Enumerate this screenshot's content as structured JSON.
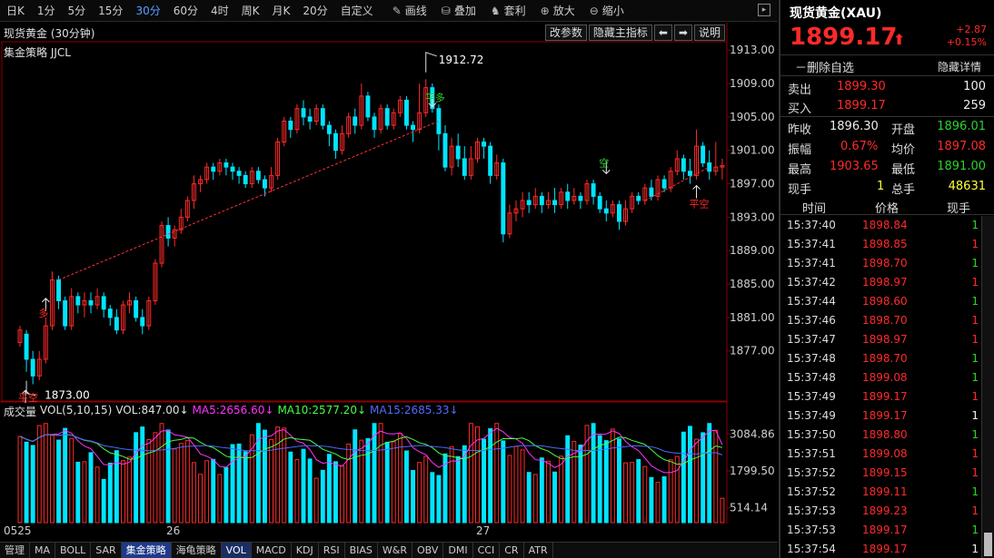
{
  "toolbar": {
    "periods": [
      "日K",
      "1分",
      "5分",
      "15分",
      "30分",
      "60分",
      "4时",
      "周K",
      "月K",
      "20分",
      "自定义"
    ],
    "active_period": "30分",
    "tools": [
      {
        "icon": "pencil-icon",
        "label": "画线"
      },
      {
        "icon": "layers-icon",
        "label": "叠加"
      },
      {
        "icon": "bag-icon",
        "label": "套利"
      },
      {
        "icon": "zoom-in-icon",
        "label": "放大"
      },
      {
        "icon": "zoom-out-icon",
        "label": "缩小"
      }
    ]
  },
  "main": {
    "title": "现货黄金 (30分钟)",
    "strategy": "集金策略 JJCL",
    "buttons": [
      "改参数",
      "隐藏主指标",
      "⬅",
      "➡",
      "说明"
    ],
    "y_ticks": [
      "1913.00",
      "1909.00",
      "1905.00",
      "1901.00",
      "1897.00",
      "1893.00",
      "1889.00",
      "1885.00",
      "1881.00",
      "1877.00"
    ],
    "annotations": {
      "high_label": "1912.72",
      "low_label": "1873.00",
      "signals": [
        "平多",
        "多",
        "空",
        "平空",
        "平空"
      ]
    }
  },
  "volume": {
    "label": "成交量",
    "params": "VOL(5,10,15)",
    "vol": "VOL:847.00↓",
    "ma5": "MA5:2656.60↓",
    "ma10": "MA10:2577.20↓",
    "ma15": "MA15:2685.33↓",
    "buttons": [
      "改参数",
      "说明",
      "X"
    ],
    "y_ticks": [
      "3084.86",
      "1799.50",
      "514.14"
    ]
  },
  "dates": [
    "0525",
    "26",
    "27"
  ],
  "bottom_tabs": [
    "管理",
    "MA",
    "BOLL",
    "SAR",
    "集金策略",
    "海龟策略",
    "VOL",
    "MACD",
    "KDJ",
    "RSI",
    "BIAS",
    "W&R",
    "OBV",
    "DMI",
    "CCI",
    "CR",
    "ATR"
  ],
  "active_tab": "集金策略",
  "highlight_tab": "VOL",
  "quote": {
    "name": "现货黄金(XAU)",
    "price": "1899.17",
    "arrow": "⬆",
    "change": "+2.87",
    "change_pct": "+0.15%",
    "delete_label": "－删除自选",
    "hide_label": "隐藏详情",
    "sell_label": "卖出",
    "sell_price": "1899.30",
    "sell_qty": "100",
    "buy_label": "买入",
    "buy_price": "1899.17",
    "buy_qty": "259",
    "prev_close_label": "昨收",
    "prev_close": "1896.30",
    "open_label": "开盘",
    "open": "1896.01",
    "amp_label": "振幅",
    "amp": "0.67%",
    "avg_label": "均价",
    "avg": "1897.08",
    "high_label": "最高",
    "high": "1903.65",
    "low_label": "最低",
    "low": "1891.00",
    "cur_label": "现手",
    "cur": "1",
    "total_label": "总手",
    "total": "48631"
  },
  "trades_header": {
    "time": "时间",
    "price": "价格",
    "qty": "现手"
  },
  "trades": [
    {
      "time": "15:37:40",
      "price": "1898.84",
      "qty": "1",
      "color": "green"
    },
    {
      "time": "15:37:41",
      "price": "1898.85",
      "qty": "1",
      "color": "red"
    },
    {
      "time": "15:37:41",
      "price": "1898.70",
      "qty": "1",
      "color": "green"
    },
    {
      "time": "15:37:42",
      "price": "1898.97",
      "qty": "1",
      "color": "red"
    },
    {
      "time": "15:37:44",
      "price": "1898.60",
      "qty": "1",
      "color": "green"
    },
    {
      "time": "15:37:46",
      "price": "1898.70",
      "qty": "1",
      "color": "red"
    },
    {
      "time": "15:37:47",
      "price": "1898.97",
      "qty": "1",
      "color": "red"
    },
    {
      "time": "15:37:48",
      "price": "1898.70",
      "qty": "1",
      "color": "green"
    },
    {
      "time": "15:37:48",
      "price": "1899.08",
      "qty": "1",
      "color": "green"
    },
    {
      "time": "15:37:49",
      "price": "1899.17",
      "qty": "1",
      "color": "red"
    },
    {
      "time": "15:37:49",
      "price": "1899.17",
      "qty": "1",
      "color": "white"
    },
    {
      "time": "15:37:50",
      "price": "1898.80",
      "qty": "1",
      "color": "green"
    },
    {
      "time": "15:37:51",
      "price": "1899.08",
      "qty": "1",
      "color": "red"
    },
    {
      "time": "15:37:52",
      "price": "1899.15",
      "qty": "1",
      "color": "red"
    },
    {
      "time": "15:37:52",
      "price": "1899.11",
      "qty": "1",
      "color": "green"
    },
    {
      "time": "15:37:53",
      "price": "1899.23",
      "qty": "1",
      "color": "red"
    },
    {
      "time": "15:37:53",
      "price": "1899.17",
      "qty": "1",
      "color": "green"
    },
    {
      "time": "15:37:54",
      "price": "1899.17",
      "qty": "1",
      "color": "white"
    }
  ],
  "colors": {
    "up": "#ff2a2a",
    "down": "#00e5ff",
    "green": "#2bd42b",
    "grid": "#8a0000"
  },
  "chart_data": [
    {
      "type": "candlestick",
      "ylim": [
        1871,
        1914
      ],
      "y_ticks": [
        1913,
        1909,
        1905,
        1901,
        1897,
        1893,
        1889,
        1885,
        1881,
        1877
      ],
      "candles": [
        [
          1878,
          1879.5,
          1877.5,
          1880
        ],
        [
          1879,
          1876,
          1874.5,
          1879.5
        ],
        [
          1876,
          1874,
          1873,
          1877
        ],
        [
          1874,
          1876,
          1873.5,
          1877
        ],
        [
          1876,
          1880,
          1875.5,
          1881
        ],
        [
          1880,
          1885.5,
          1879.5,
          1886.5
        ],
        [
          1885.5,
          1883,
          1882,
          1886
        ],
        [
          1883,
          1880,
          1879.5,
          1883.5
        ],
        [
          1880,
          1883.5,
          1879.5,
          1884.5
        ],
        [
          1883.5,
          1882.5,
          1881.5,
          1884
        ],
        [
          1882.5,
          1883,
          1881,
          1884
        ],
        [
          1883,
          1882.5,
          1881.5,
          1884
        ],
        [
          1882.5,
          1883.5,
          1882,
          1884.5
        ],
        [
          1883.5,
          1882,
          1881,
          1884
        ],
        [
          1882,
          1881,
          1880,
          1882.5
        ],
        [
          1881,
          1879.5,
          1879,
          1882
        ],
        [
          1879.5,
          1882.5,
          1879,
          1883
        ],
        [
          1882.5,
          1883,
          1881.5,
          1884
        ],
        [
          1883,
          1881,
          1880.5,
          1883.5
        ],
        [
          1881,
          1880,
          1879,
          1882
        ],
        [
          1880,
          1883,
          1879.5,
          1883.5
        ],
        [
          1883,
          1887.5,
          1882.5,
          1888
        ],
        [
          1887.5,
          1892,
          1887,
          1892.5
        ],
        [
          1892,
          1890.5,
          1889.5,
          1893
        ],
        [
          1890.5,
          1891.5,
          1889.5,
          1892
        ],
        [
          1891.5,
          1893,
          1891,
          1894
        ],
        [
          1893,
          1895,
          1892.5,
          1895.5
        ],
        [
          1895,
          1897,
          1894,
          1898
        ],
        [
          1897,
          1897.5,
          1896,
          1898
        ],
        [
          1897.5,
          1899,
          1897,
          1899.5
        ],
        [
          1899,
          1898.5,
          1897.5,
          1899.5
        ],
        [
          1898.5,
          1899.5,
          1898,
          1900
        ],
        [
          1899.5,
          1899,
          1898,
          1900
        ],
        [
          1899,
          1898.5,
          1897.5,
          1899.5
        ],
        [
          1898.5,
          1898,
          1897,
          1899
        ],
        [
          1898,
          1897,
          1896.5,
          1898.5
        ],
        [
          1897,
          1898.5,
          1896.5,
          1899
        ],
        [
          1898.5,
          1897.5,
          1897,
          1899
        ],
        [
          1897.5,
          1896.5,
          1895.5,
          1898
        ],
        [
          1896.5,
          1898,
          1896,
          1899
        ],
        [
          1898,
          1902,
          1897.5,
          1902.5
        ],
        [
          1902,
          1904.5,
          1901.5,
          1905
        ],
        [
          1904.5,
          1903.5,
          1902.5,
          1905
        ],
        [
          1903.5,
          1906,
          1903,
          1906.5
        ],
        [
          1906,
          1905,
          1904,
          1907
        ],
        [
          1905,
          1904.5,
          1903.5,
          1906
        ],
        [
          1904.5,
          1906,
          1904,
          1906.5
        ],
        [
          1906,
          1904,
          1903.5,
          1906.5
        ],
        [
          1904,
          1903,
          1901.5,
          1904.5
        ],
        [
          1903,
          1901,
          1900,
          1903.5
        ],
        [
          1901,
          1903,
          1900.5,
          1904
        ],
        [
          1903,
          1905,
          1902.5,
          1905.5
        ],
        [
          1905,
          1904,
          1903,
          1906
        ],
        [
          1904,
          1907.5,
          1903.5,
          1909
        ],
        [
          1907.5,
          1905,
          1904.5,
          1908
        ],
        [
          1905,
          1903.5,
          1902.5,
          1905.5
        ],
        [
          1903.5,
          1906,
          1903,
          1906.5
        ],
        [
          1906,
          1904,
          1903.5,
          1906.5
        ],
        [
          1904,
          1905.5,
          1903.5,
          1906
        ],
        [
          1905.5,
          1907,
          1905,
          1907.5
        ],
        [
          1907,
          1904,
          1903.5,
          1907.5
        ],
        [
          1904,
          1903.5,
          1902,
          1904.5
        ],
        [
          1903.5,
          1905.5,
          1903,
          1909
        ],
        [
          1905.5,
          1908.5,
          1905,
          1909.5
        ],
        [
          1908.5,
          1906,
          1905.5,
          1909
        ],
        [
          1906,
          1903,
          1901,
          1906.5
        ],
        [
          1903,
          1899,
          1898.5,
          1904
        ],
        [
          1899,
          1901.5,
          1898,
          1902.5
        ],
        [
          1901.5,
          1900,
          1899,
          1903
        ],
        [
          1900,
          1898,
          1897.5,
          1901.5
        ],
        [
          1898,
          1900,
          1897.5,
          1901.5
        ],
        [
          1900,
          1902,
          1899.5,
          1902.5
        ],
        [
          1902,
          1901.5,
          1900,
          1902.5
        ],
        [
          1901.5,
          1898,
          1897,
          1902
        ],
        [
          1898,
          1899.5,
          1897.5,
          1900.5
        ],
        [
          1899.5,
          1891,
          1890,
          1900
        ],
        [
          1891,
          1893.5,
          1890.5,
          1894.5
        ],
        [
          1893.5,
          1894,
          1892.5,
          1895
        ],
        [
          1894,
          1895,
          1893,
          1896
        ],
        [
          1895,
          1894.5,
          1893.5,
          1896
        ],
        [
          1894.5,
          1895.5,
          1894,
          1896.5
        ],
        [
          1895.5,
          1894.5,
          1893.5,
          1896
        ],
        [
          1894.5,
          1895,
          1894,
          1896
        ],
        [
          1895,
          1894.5,
          1893.5,
          1896.5
        ],
        [
          1894.5,
          1896,
          1894,
          1896.5
        ],
        [
          1896,
          1895,
          1894,
          1897
        ],
        [
          1895,
          1895.5,
          1894.5,
          1896.5
        ],
        [
          1895.5,
          1895,
          1894,
          1896
        ],
        [
          1895,
          1897,
          1894.5,
          1897.5
        ],
        [
          1897,
          1895.5,
          1894.5,
          1897.5
        ],
        [
          1895.5,
          1894,
          1893.5,
          1896
        ],
        [
          1894,
          1893.5,
          1892.5,
          1895
        ],
        [
          1893.5,
          1894.5,
          1893,
          1895
        ],
        [
          1894.5,
          1892.5,
          1891.5,
          1895
        ],
        [
          1892.5,
          1894,
          1892,
          1895
        ],
        [
          1894,
          1895.5,
          1893.5,
          1896
        ],
        [
          1895.5,
          1895,
          1894.5,
          1896
        ],
        [
          1895,
          1896.5,
          1894.5,
          1897
        ],
        [
          1896.5,
          1895.5,
          1895,
          1897.5
        ],
        [
          1895.5,
          1897.5,
          1895,
          1898
        ],
        [
          1897.5,
          1896.5,
          1896,
          1898
        ],
        [
          1896.5,
          1898.5,
          1896,
          1899
        ],
        [
          1898.5,
          1900,
          1898,
          1901
        ],
        [
          1900,
          1898.5,
          1897.5,
          1900.5
        ],
        [
          1898.5,
          1898,
          1897,
          1900
        ],
        [
          1898,
          1901.5,
          1897.5,
          1903.5
        ],
        [
          1901.5,
          1899.5,
          1899,
          1902
        ],
        [
          1899.5,
          1898.5,
          1897.5,
          1901
        ],
        [
          1898.5,
          1899,
          1898,
          1902
        ],
        [
          1899,
          1899.17,
          1897.5,
          1900
        ]
      ],
      "trendlines": [
        {
          "from": [
            6,
            1885.5
          ],
          "to": [
            65,
            1904.5
          ]
        },
        {
          "from": [
            97,
            1895
          ],
          "to": [
            107,
            1899
          ]
        }
      ]
    },
    {
      "type": "bar",
      "ylim": [
        0,
        3600
      ],
      "y_ticks": [
        3084.86,
        1799.5,
        514.14
      ]
    }
  ]
}
